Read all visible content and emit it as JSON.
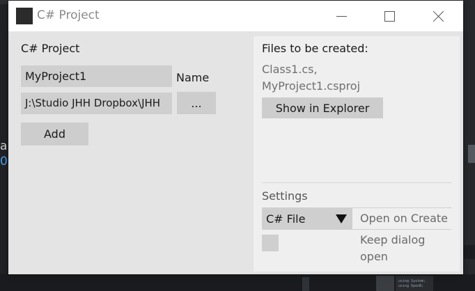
{
  "background": {
    "left_text_1": "a",
    "left_text_2": "0",
    "mini_1": "using System;",
    "mini_2": "using OpenB;"
  },
  "window": {
    "title": "C# Project"
  },
  "left": {
    "section_label": "C# Project",
    "name_value": "MyProject1",
    "name_label": "Name",
    "path_value": "J:\\Studio JHH Dropbox\\JHH",
    "browse_label": "...",
    "add_label": "Add"
  },
  "right": {
    "files_heading": "Files to be created:",
    "files": [
      "Class1.cs,",
      "MyProject1.csproj"
    ],
    "explorer_label": "Show in Explorer",
    "settings_label": "Settings",
    "file_type_selected": "C# File",
    "open_on_create_label": "Open on Create",
    "keep_dialog_label": "Keep dialog open"
  }
}
